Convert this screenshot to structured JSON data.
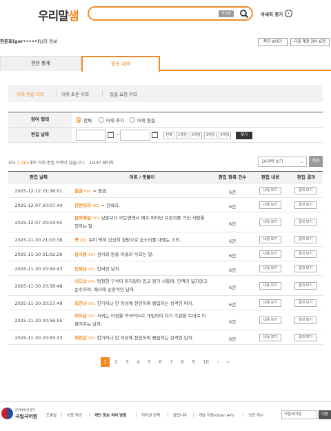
{
  "header": {
    "logo_part1": "우리말",
    "logo_part2": "샘",
    "search_chip": "옛한글",
    "more_search": "자세히 찾기"
  },
  "userbar": {
    "name": "한준호(gor•••••)",
    "suffix": "님의 정보",
    "btn_notify": "쪽지 보내기",
    "btn_multi": "다중 계정 검사 요청"
  },
  "tabs": [
    "편찬 통계",
    "활동 내역"
  ],
  "subnav": [
    "어휘 편집 이력",
    "어휘 토론 이력",
    "집필 요청 이력"
  ],
  "filter": {
    "type_label": "참여 형태",
    "types": [
      "전체",
      "어휘 추가",
      "어휘 편집"
    ],
    "date_label": "편집 날짜",
    "tilde": "~",
    "periods": [
      "전체",
      "1개월",
      "2개월",
      "3개월",
      "6개월"
    ],
    "find": "찾기"
  },
  "summary": {
    "prefix": "모두 ",
    "count": "2,365",
    "middle": "개의 어휘 편집 이력이 있습니다.",
    "page_current": "1",
    "page_total": "/237 페이지"
  },
  "view_select": "10개씩 보기",
  "apply": "적용",
  "table": {
    "headers": [
      "편집 날짜",
      "어휘 / 뜻풀이",
      "편집 항목 건수",
      "편집 내용",
      "편집 결과"
    ],
    "btn_content": "내용 보기",
    "btn_result": "결과 보기",
    "rows": [
      {
        "date": "2025-12-12 21:36:01",
        "word": "흥금",
        "num": "001",
        "def": "= 팜금.",
        "count": "6건"
      },
      {
        "date": "2025-12-07 20:07:44",
        "word": "잔판머리",
        "num": "001",
        "def": "= 잔바리.",
        "count": "6건"
      },
      {
        "date": "2025-12-07 20:04:55",
        "word": "알파메일",
        "num": "002",
        "def": "남들보다 모든면에서 매우 뛰어난 유전자를 가진 사람을 칭하는 말.",
        "count": "6건"
      },
      {
        "date": "2025-11-30 21:03:38",
        "word": "콕",
        "num": "001",
        "def": "목이 막혀 간신히 힘받으로 숨소리를 내뱉는 소리.",
        "count": "6건"
      },
      {
        "date": "2025-11-30 21:02:26",
        "word": "섬사동",
        "num": "001",
        "def": "섬사와 동을 아울러 부르는 말.",
        "count": "6건"
      },
      {
        "date": "2025-11-30 20:59:43",
        "word": "인싸남",
        "num": "001",
        "def": "인싸인 남자.",
        "count": "6건"
      },
      {
        "date": "2025-11-30 20:58:48",
        "word": "너드남",
        "num": "001",
        "def": "멍청한 구석이 미치않아 있고 뭔가 서툴며, 인맥이 넓지않고 순수하며, 매사에 순종적인 남자",
        "count": "6건"
      },
      {
        "date": "2025-11-30 20:57:49",
        "word": "직진녀",
        "num": "001",
        "def": "한가지나 한 이성에 전진하며 몰입하는 성격인 여자.",
        "count": "6건"
      },
      {
        "date": "2025-11-30 20:56:55",
        "word": "리드남",
        "num": "001",
        "def": "사귀는 이성을 적극적으로 개입하여 자기 주관을 토대로 이끌어주는 남자.",
        "count": "6건"
      },
      {
        "date": "2025-11-30 20:55:33",
        "word": "직진남",
        "num": "001",
        "def": "한가지나 한 이성에 전진하며 몰입하는 성격인 남자.",
        "count": "6건"
      }
    ]
  },
  "pagination": [
    "1",
    "2",
    "3",
    "4",
    "5",
    "6",
    "7",
    "8",
    "9",
    "10",
    "›",
    "››"
  ],
  "footer": {
    "org_small": "문화체육관광부",
    "org": "국립국어원",
    "links": [
      "도움말",
      "이용 약관",
      "개인 정보 처리 방침",
      "저작권 정책",
      "알립니다",
      "개발 지원(Open API)",
      "의견 게시"
    ],
    "select": "국립국어원",
    "go": "이동"
  },
  "colors": {
    "accent": "#f08a24",
    "dark": "#333333"
  }
}
